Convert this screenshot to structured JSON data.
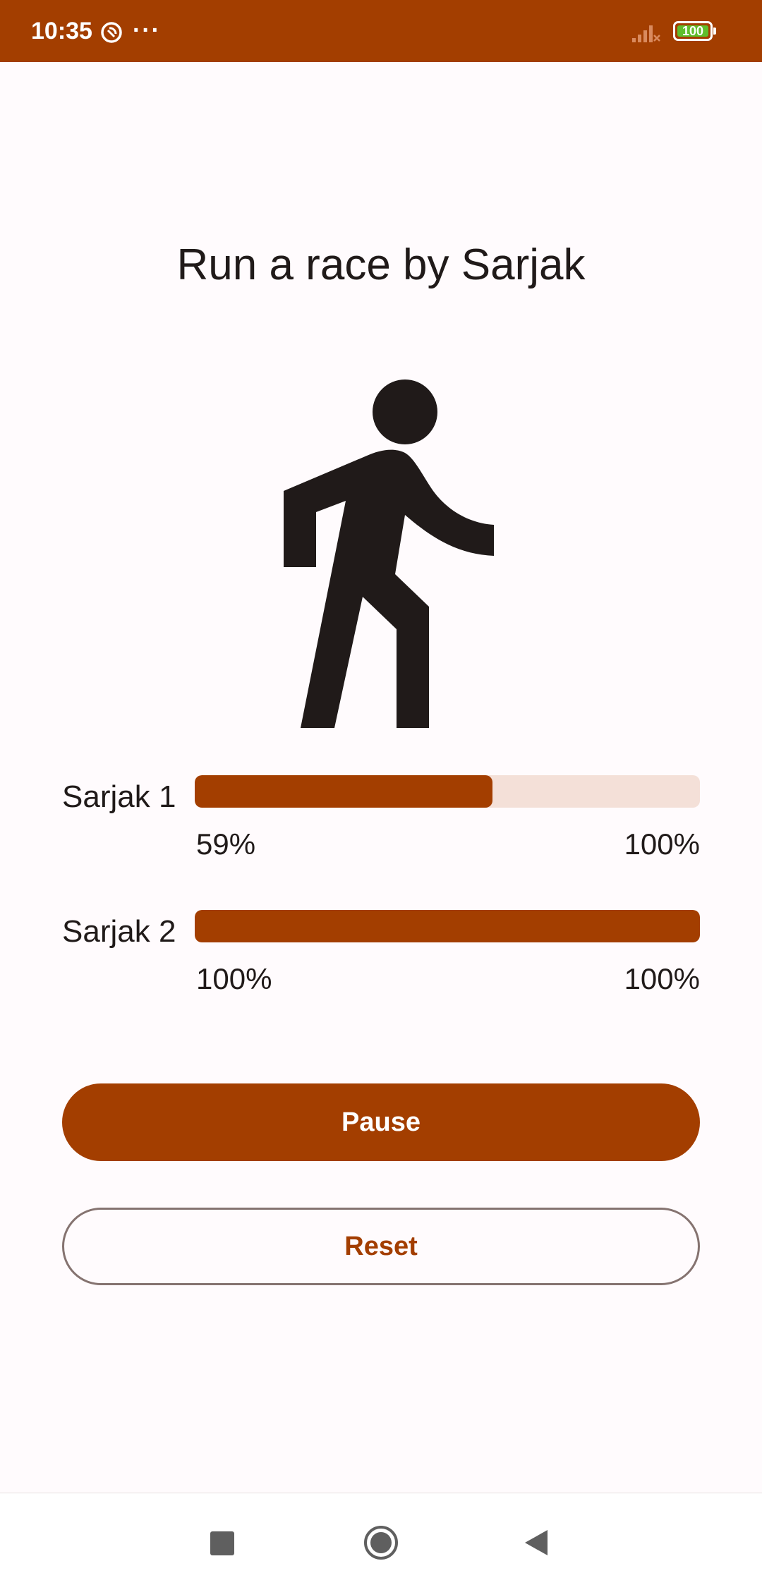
{
  "status_bar": {
    "time": "10:35",
    "dnd_icon": "do-not-disturb-icon",
    "more_icon": "more-dots-icon",
    "signal_icon": "signal-no-service-icon",
    "battery_level": "100",
    "background_color": "#a33e00"
  },
  "main": {
    "title": "Run a race by Sarjak",
    "illustration_icon": "walking-person-icon"
  },
  "racers": [
    {
      "label": "Sarjak 1",
      "progress_fraction": 0.59,
      "progress_text": "59%",
      "max_text": "100%"
    },
    {
      "label": "Sarjak 2",
      "progress_fraction": 1.0,
      "progress_text": "100%",
      "max_text": "100%"
    }
  ],
  "buttons": {
    "pause_label": "Pause",
    "reset_label": "Reset"
  },
  "navigation": {
    "recents_icon": "square-recents-icon",
    "home_icon": "circle-home-icon",
    "back_icon": "triangle-back-icon"
  },
  "colors": {
    "accent": "#a33e00",
    "track": "#f4e0d8",
    "background": "#fffbfd",
    "text": "#201a19",
    "outline": "#857370"
  }
}
